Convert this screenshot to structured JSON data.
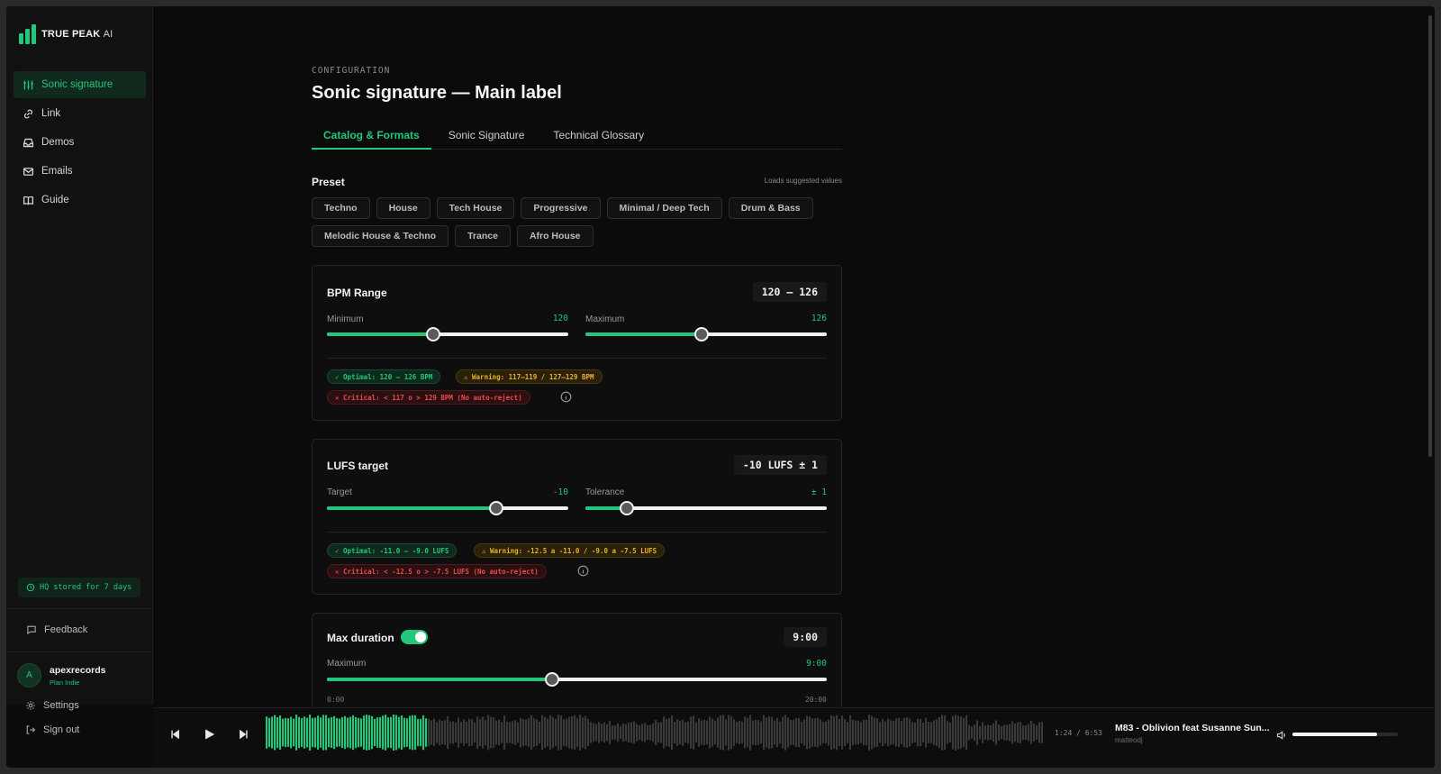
{
  "brand": {
    "name": "TRUE PEAK",
    "suffix": "AI",
    "accent": "#22c77a"
  },
  "sidebar": {
    "items": [
      {
        "label": "Sonic signature",
        "icon": "sliders-icon",
        "active": true
      },
      {
        "label": "Link",
        "icon": "link-icon"
      },
      {
        "label": "Demos",
        "icon": "inbox-icon"
      },
      {
        "label": "Emails",
        "icon": "mail-icon"
      },
      {
        "label": "Guide",
        "icon": "book-icon"
      }
    ],
    "storage_note": "HQ stored for 7 days",
    "feedback": "Feedback",
    "user": {
      "initial": "A",
      "name": "apexrecords",
      "plan": "Plan Indie"
    },
    "settings": "Settings",
    "signout": "Sign out"
  },
  "header": {
    "eyebrow": "CONFIGURATION",
    "title": "Sonic signature — Main label"
  },
  "tabs": [
    {
      "label": "Catalog & Formats",
      "active": true
    },
    {
      "label": "Sonic Signature"
    },
    {
      "label": "Technical Glossary"
    }
  ],
  "preset": {
    "label": "Preset",
    "hint": "Loads suggested values",
    "options": [
      "Techno",
      "House",
      "Tech House",
      "Progressive",
      "Minimal / Deep Tech",
      "Drum & Bass",
      "Melodic House & Techno",
      "Trance",
      "Afro House"
    ]
  },
  "bpm": {
    "title": "BPM Range",
    "display": "120 – 126",
    "min_label": "Minimum",
    "min_value": "120",
    "min_fraction": 0.44,
    "max_label": "Maximum",
    "max_value": "126",
    "max_fraction": 0.48,
    "optimal": "✓ Optimal: 120 – 126 BPM",
    "warning": "⚠ Warning: 117–119 / 127–129 BPM",
    "critical": "✕ Critical: < 117 o > 129 BPM (No auto-reject)"
  },
  "lufs": {
    "title": "LUFS target",
    "display": "-10 LUFS ± 1",
    "target_label": "Target",
    "target_value": "-10",
    "target_fraction": 0.7,
    "tol_label": "Tolerance",
    "tol_value": "± 1",
    "tol_fraction": 0.17,
    "optimal": "✓ Optimal: -11.0 – -9.0 LUFS",
    "warning": "⚠ Warning: -12.5 a -11.0 / -9.0 a -7.5 LUFS",
    "critical": "✕ Critical: < -12.5 o > -7.5 LUFS (No auto-reject)"
  },
  "duration": {
    "title": "Max duration",
    "enabled": true,
    "display": "9:00",
    "max_label": "Maximum",
    "max_value": "9:00",
    "fraction": 0.45,
    "scale_min": "0:00",
    "scale_max": "20:00"
  },
  "player": {
    "time": "1:24 / 6:53",
    "title": "M83 - Oblivion feat Susanne Sun...",
    "artist": "matteodj",
    "progress": 0.207,
    "volume": 0.8
  }
}
